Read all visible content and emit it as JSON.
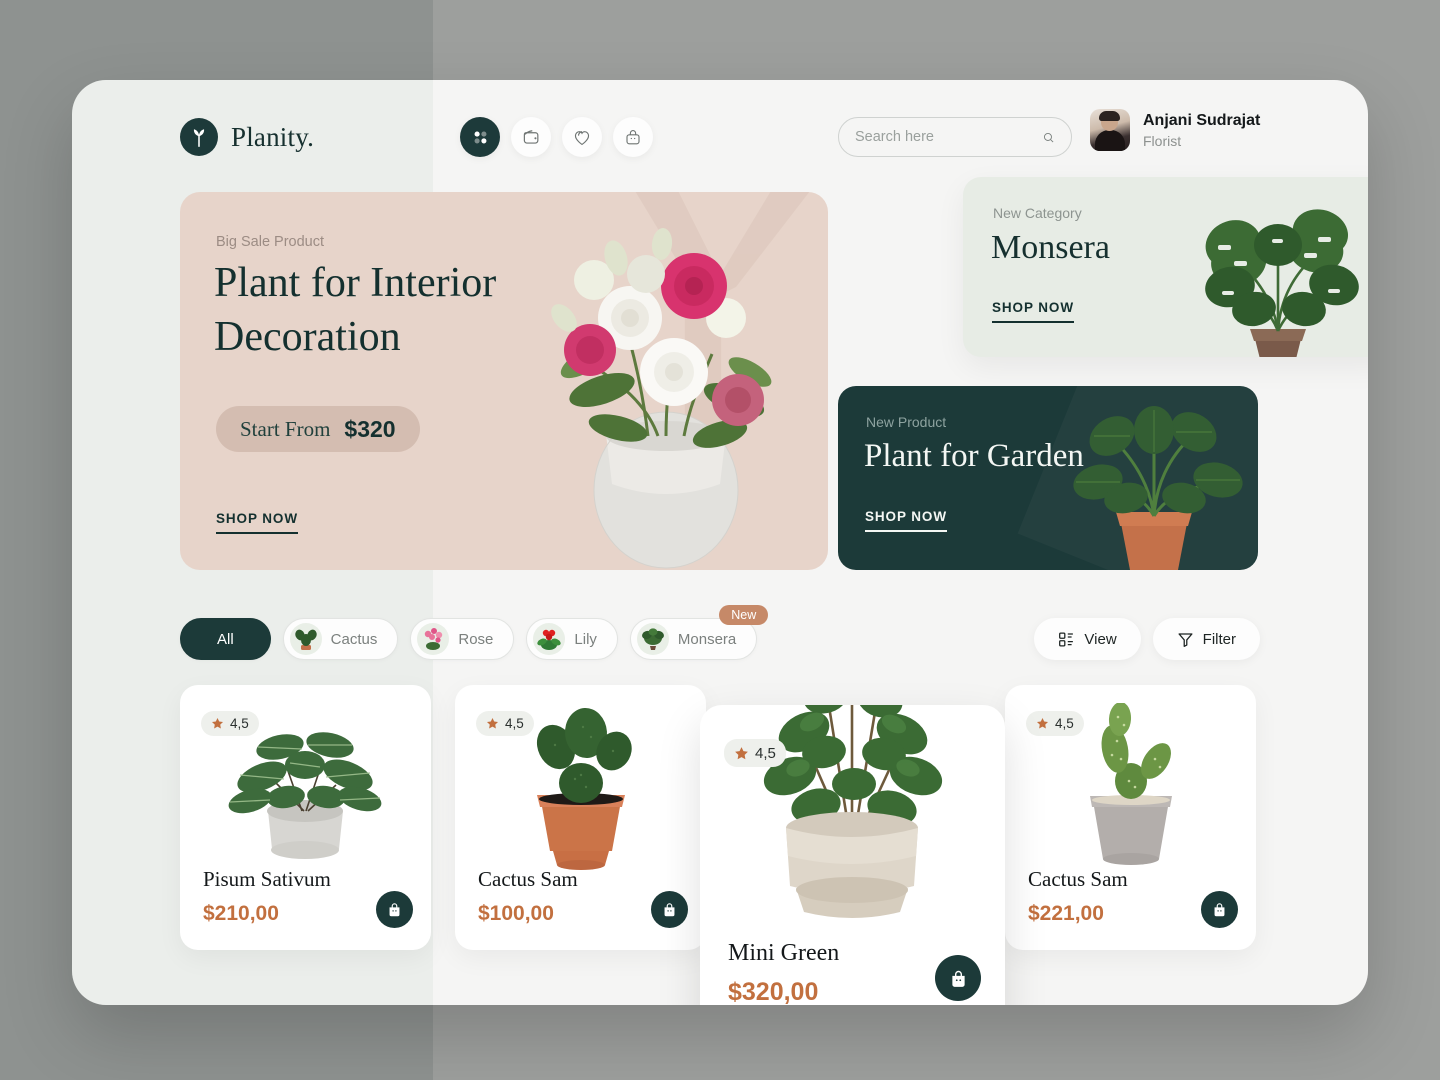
{
  "brand": {
    "name": "Planity.",
    "logo_icon": "sprout-logo-icon"
  },
  "nav": [
    {
      "icon": "grid-dashboard-icon",
      "label": "Dashboard",
      "active": true
    },
    {
      "icon": "wallet-icon",
      "label": "Wallet",
      "active": false
    },
    {
      "icon": "heart-icon",
      "label": "Favorites",
      "active": false
    },
    {
      "icon": "bag-icon",
      "label": "Cart",
      "active": false
    }
  ],
  "search": {
    "placeholder": "Search here",
    "value": "",
    "icon": "search-icon"
  },
  "profile": {
    "name": "Anjani Sudrajat",
    "role": "Florist",
    "avatar_alt": "user-avatar"
  },
  "hero": {
    "label": "Big Sale Product",
    "title": "Plant for Interior Decoration",
    "start_from_label": "Start From",
    "price": "$320",
    "cta": "SHOP NOW",
    "bg_color": "#e7d4ca"
  },
  "category_card": {
    "label": "New Category",
    "title": "Monsera",
    "cta": "SHOP NOW",
    "bg_color": "#e7ece5"
  },
  "product_card": {
    "label": "New Product",
    "title": "Plant for Garden",
    "cta": "SHOP NOW",
    "bg_color": "#1c3a39"
  },
  "filters": {
    "chips": [
      {
        "label": "All",
        "active": true,
        "thumb": null,
        "badge": null
      },
      {
        "label": "Cactus",
        "active": false,
        "thumb": "cactus-thumb",
        "badge": null
      },
      {
        "label": "Rose",
        "active": false,
        "thumb": "rose-thumb",
        "badge": null
      },
      {
        "label": "Lily",
        "active": false,
        "thumb": "lily-thumb",
        "badge": null
      },
      {
        "label": "Monsera",
        "active": false,
        "thumb": "monsera-thumb",
        "badge": "New"
      }
    ],
    "view_label": "View",
    "view_icon": "grid-view-icon",
    "filter_label": "Filter",
    "filter_icon": "funnel-filter-icon"
  },
  "products": [
    {
      "name": "Pisum Sativum",
      "price": "$210,00",
      "rating": "4,5",
      "art": "peperomia",
      "featured": false
    },
    {
      "name": "Cactus Sam",
      "price": "$100,00",
      "rating": "4,5",
      "art": "bunny-cactus-terracotta",
      "featured": false
    },
    {
      "name": "Mini Green",
      "price": "$320,00",
      "rating": "4,5",
      "art": "mini-green-plant",
      "featured": true
    },
    {
      "name": "Cactus Sam",
      "price": "$221,00",
      "rating": "4,5",
      "art": "bunny-cactus-grey",
      "featured": false
    }
  ],
  "colors": {
    "accent_dark": "#1c3a39",
    "price": "#c2703f",
    "badge_new": "#c68968",
    "hero_bg": "#e7d4ca",
    "panel_left": "#ebeeeb",
    "panel_right": "#f5f5f4"
  }
}
